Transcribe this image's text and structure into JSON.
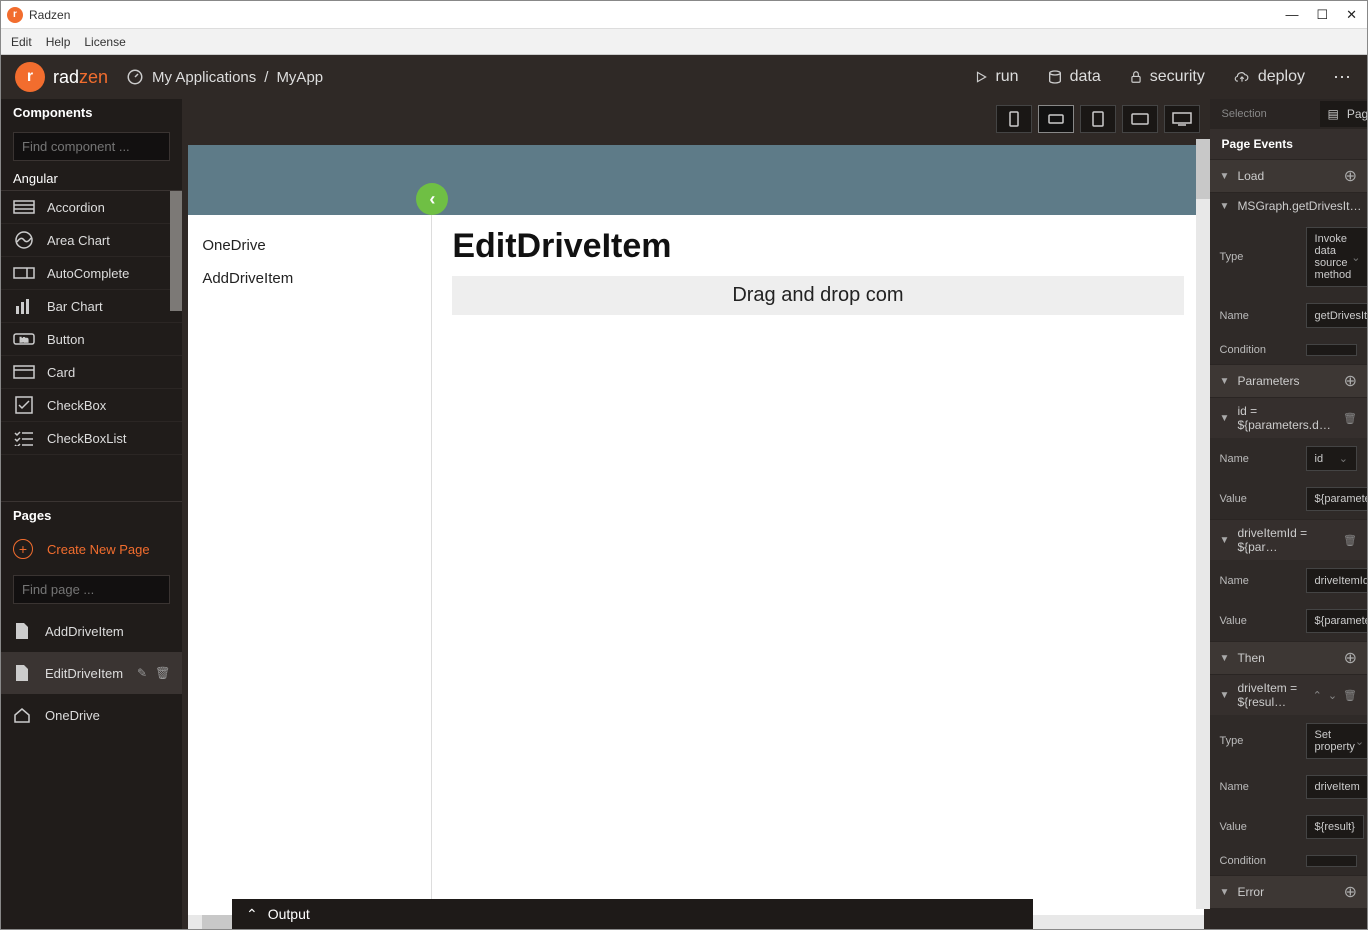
{
  "window": {
    "title": "Radzen"
  },
  "menubar": [
    "Edit",
    "Help",
    "License"
  ],
  "topnav": {
    "brand": "radzen",
    "breadcrumb": [
      "My Applications",
      "MyApp"
    ],
    "actions": {
      "run": "run",
      "data": "data",
      "security": "security",
      "deploy": "deploy"
    }
  },
  "sidebar": {
    "components_hdr": "Components",
    "find_component_placeholder": "Find component ...",
    "group": "Angular",
    "pages_hdr": "Pages",
    "find_page_placeholder": "Find page ...",
    "create_page": "Create New Page",
    "components": [
      {
        "name": "Accordion"
      },
      {
        "name": "Area Chart"
      },
      {
        "name": "AutoComplete"
      },
      {
        "name": "Bar Chart"
      },
      {
        "name": "Button"
      },
      {
        "name": "Card"
      },
      {
        "name": "CheckBox"
      },
      {
        "name": "CheckBoxList"
      }
    ],
    "pages": [
      {
        "name": "AddDriveItem",
        "active": false
      },
      {
        "name": "EditDriveItem",
        "active": true
      },
      {
        "name": "OneDrive",
        "active": false
      }
    ]
  },
  "canvas": {
    "side_items": [
      "OneDrive",
      "AddDriveItem"
    ],
    "heading": "EditDriveItem",
    "drop_hint": "Drag and drop com"
  },
  "rightp": {
    "selection_label": "Selection",
    "selection_value": "Page",
    "events_hdr": "Page Events",
    "load": "Load",
    "handler1": {
      "title": "MSGraph.getDrivesIt…",
      "type_label": "Type",
      "type_value": "Invoke data source method",
      "name_label": "Name",
      "name_value": "getDrivesItemsById",
      "cond_label": "Condition",
      "cond_value": "",
      "params_hdr": "Parameters",
      "param1": {
        "title": "id = ${parameters.d…",
        "name_label": "Name",
        "name_value": "id",
        "value_label": "Value",
        "value_value": "${parameters.driveId}"
      },
      "param2": {
        "title": "driveItemId = ${par…",
        "name_label": "Name",
        "name_value": "driveItemId",
        "value_label": "Value",
        "value_value": "${parameters.itemId}"
      },
      "then_hdr": "Then",
      "then1": {
        "title": "driveItem = ${resul…",
        "type_label": "Type",
        "type_value": "Set property",
        "name_label": "Name",
        "name_value": "driveItem",
        "value_label": "Value",
        "value_value": "${result}",
        "cond_label": "Condition",
        "cond_value": ""
      },
      "error_hdr": "Error"
    }
  },
  "output": "Output"
}
